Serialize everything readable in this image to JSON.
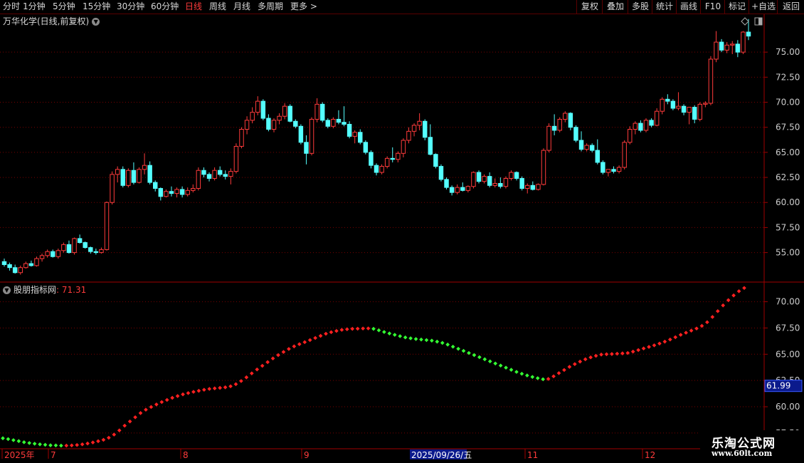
{
  "toolbar": {
    "periods": [
      "分时",
      "1分钟",
      "5分钟",
      "15分钟",
      "30分钟",
      "60分钟",
      "日线",
      "周线",
      "月线",
      "多周期",
      "更多 >"
    ],
    "active_period": "日线",
    "right_buttons": [
      "复权",
      "叠加",
      "多股",
      "统计",
      "画线",
      "F10",
      "标记",
      "+自选",
      "返回"
    ]
  },
  "chart_title": "万华化学(日线,前复权)",
  "indicator": {
    "name": "股朋指标网",
    "value": ": 71.31",
    "highlight_value": "61.99"
  },
  "main_axis": {
    "ticks": [
      "75.00",
      "72.50",
      "70.00",
      "67.50",
      "65.00",
      "62.50",
      "60.00",
      "57.50",
      "55.00"
    ]
  },
  "ind_axis": {
    "ticks": [
      "70.00",
      "67.50",
      "65.00",
      "62.50",
      "60.00",
      "57.50"
    ]
  },
  "date_axis": {
    "labels": [
      "2025年",
      "7",
      "8",
      "9",
      "11",
      "12"
    ],
    "cursor_date": "2025/09/26/五"
  },
  "colors": {
    "up": "#ff3b3b",
    "down": "#54ffff",
    "grid": "#7a0000",
    "border": "#a00000",
    "line_up": "#ff2020",
    "line_down": "#33ff33"
  },
  "watermark": {
    "line1": "乐淘公式网",
    "line2": "www.60lt.com"
  },
  "chart_data": {
    "type": "candlestick",
    "main": {
      "ylim": [
        52.2,
        77.5
      ],
      "candles": [
        [
          54.1,
          54.4,
          53.6,
          53.8
        ],
        [
          53.8,
          54.0,
          53.2,
          53.5
        ],
        [
          53.5,
          53.8,
          52.9,
          53.0
        ],
        [
          53.0,
          53.7,
          52.8,
          53.5
        ],
        [
          53.5,
          54.1,
          53.4,
          53.9
        ],
        [
          53.9,
          54.2,
          53.6,
          53.7
        ],
        [
          53.7,
          54.6,
          53.6,
          54.4
        ],
        [
          54.4,
          54.9,
          54.1,
          54.7
        ],
        [
          54.7,
          55.3,
          54.5,
          55.1
        ],
        [
          55.1,
          55.3,
          54.5,
          54.6
        ],
        [
          54.6,
          55.4,
          54.4,
          55.2
        ],
        [
          55.2,
          56.0,
          55.0,
          55.8
        ],
        [
          55.8,
          56.2,
          54.9,
          55.0
        ],
        [
          55.0,
          56.5,
          54.8,
          56.4
        ],
        [
          56.4,
          56.8,
          55.9,
          56.0
        ],
        [
          56.0,
          56.1,
          55.4,
          55.5
        ],
        [
          55.5,
          55.6,
          54.9,
          55.1
        ],
        [
          55.1,
          55.4,
          54.8,
          55.0
        ],
        [
          55.0,
          55.5,
          54.9,
          55.3
        ],
        [
          55.3,
          60.1,
          55.2,
          60.0
        ],
        [
          60.0,
          63.1,
          59.8,
          62.8
        ],
        [
          62.8,
          63.6,
          62.0,
          63.3
        ],
        [
          63.3,
          63.6,
          61.5,
          61.7
        ],
        [
          61.7,
          63.4,
          61.5,
          63.2
        ],
        [
          63.2,
          64.0,
          61.8,
          62.0
        ],
        [
          62.0,
          63.5,
          61.9,
          63.3
        ],
        [
          63.3,
          64.9,
          62.8,
          63.7
        ],
        [
          63.7,
          64.1,
          61.8,
          62.0
        ],
        [
          62.0,
          62.2,
          61.1,
          61.4
        ],
        [
          61.4,
          61.5,
          60.2,
          60.6
        ],
        [
          60.6,
          61.3,
          60.5,
          61.1
        ],
        [
          61.1,
          61.6,
          60.6,
          60.9
        ],
        [
          60.9,
          61.5,
          60.5,
          61.3
        ],
        [
          61.3,
          61.6,
          60.5,
          60.8
        ],
        [
          60.8,
          61.5,
          60.6,
          61.2
        ],
        [
          61.2,
          61.8,
          61.0,
          61.4
        ],
        [
          61.4,
          63.5,
          61.2,
          63.2
        ],
        [
          63.2,
          63.5,
          62.5,
          62.8
        ],
        [
          62.8,
          63.0,
          62.1,
          62.4
        ],
        [
          62.4,
          63.5,
          62.2,
          63.2
        ],
        [
          63.2,
          63.6,
          62.6,
          62.8
        ],
        [
          62.8,
          63.2,
          62.3,
          62.6
        ],
        [
          62.6,
          63.4,
          61.8,
          63.1
        ],
        [
          63.1,
          65.9,
          62.9,
          65.6
        ],
        [
          65.6,
          67.5,
          65.4,
          67.3
        ],
        [
          67.3,
          68.6,
          66.8,
          68.2
        ],
        [
          68.2,
          69.5,
          67.9,
          69.0
        ],
        [
          69.0,
          70.6,
          68.7,
          70.1
        ],
        [
          70.1,
          70.3,
          68.2,
          68.4
        ],
        [
          68.4,
          68.8,
          67.1,
          67.3
        ],
        [
          67.3,
          68.4,
          67.0,
          68.2
        ],
        [
          68.2,
          68.9,
          67.8,
          68.6
        ],
        [
          68.6,
          69.9,
          68.3,
          69.6
        ],
        [
          69.6,
          69.8,
          68.0,
          68.1
        ],
        [
          68.1,
          68.3,
          67.4,
          67.6
        ],
        [
          67.6,
          67.8,
          65.8,
          66.0
        ],
        [
          66.0,
          66.7,
          63.8,
          64.9
        ],
        [
          64.9,
          68.5,
          64.7,
          68.3
        ],
        [
          68.3,
          70.4,
          68.0,
          69.8
        ],
        [
          69.8,
          70.0,
          68.0,
          68.2
        ],
        [
          68.2,
          68.4,
          67.4,
          67.6
        ],
        [
          67.6,
          68.5,
          67.4,
          68.3
        ],
        [
          68.3,
          69.2,
          67.8,
          68.0
        ],
        [
          68.0,
          69.6,
          67.6,
          67.8
        ],
        [
          67.8,
          68.1,
          66.4,
          66.6
        ],
        [
          66.6,
          67.2,
          65.9,
          67.0
        ],
        [
          67.0,
          67.3,
          65.8,
          66.0
        ],
        [
          66.0,
          66.2,
          64.8,
          65.0
        ],
        [
          65.0,
          65.2,
          63.4,
          63.7
        ],
        [
          63.7,
          63.9,
          62.7,
          63.0
        ],
        [
          63.0,
          63.8,
          62.8,
          63.6
        ],
        [
          63.6,
          64.6,
          63.4,
          64.4
        ],
        [
          64.4,
          65.5,
          64.0,
          64.3
        ],
        [
          64.3,
          65.1,
          64.0,
          64.9
        ],
        [
          64.9,
          66.4,
          64.5,
          66.2
        ],
        [
          66.2,
          67.5,
          65.9,
          67.1
        ],
        [
          67.1,
          67.9,
          66.6,
          67.7
        ],
        [
          67.7,
          68.9,
          67.2,
          68.1
        ],
        [
          68.1,
          68.3,
          66.2,
          66.5
        ],
        [
          66.5,
          67.8,
          64.7,
          64.8
        ],
        [
          64.8,
          64.9,
          63.4,
          63.6
        ],
        [
          63.6,
          63.8,
          62.1,
          62.3
        ],
        [
          62.3,
          62.5,
          61.3,
          61.5
        ],
        [
          61.5,
          61.7,
          60.7,
          61.0
        ],
        [
          61.0,
          61.8,
          60.8,
          61.5
        ],
        [
          61.5,
          62.0,
          61.1,
          61.2
        ],
        [
          61.2,
          61.7,
          61.0,
          61.6
        ],
        [
          61.6,
          63.1,
          61.4,
          63.0
        ],
        [
          63.0,
          63.2,
          61.9,
          62.1
        ],
        [
          62.1,
          62.8,
          61.9,
          62.6
        ],
        [
          62.6,
          63.0,
          61.5,
          61.7
        ],
        [
          61.7,
          62.4,
          61.5,
          61.9
        ],
        [
          61.9,
          62.5,
          61.4,
          61.6
        ],
        [
          61.6,
          62.6,
          61.4,
          62.4
        ],
        [
          62.4,
          63.2,
          62.2,
          63.0
        ],
        [
          63.0,
          63.1,
          62.2,
          62.4
        ],
        [
          62.4,
          62.6,
          61.2,
          61.4
        ],
        [
          61.4,
          61.9,
          60.9,
          61.7
        ],
        [
          61.7,
          62.1,
          61.2,
          61.3
        ],
        [
          61.3,
          61.9,
          61.2,
          61.8
        ],
        [
          61.8,
          65.4,
          61.7,
          65.2
        ],
        [
          65.2,
          67.9,
          65.0,
          67.6
        ],
        [
          67.6,
          68.8,
          66.7,
          67.2
        ],
        [
          67.2,
          68.5,
          67.0,
          68.3
        ],
        [
          68.3,
          69.1,
          68.0,
          68.9
        ],
        [
          68.9,
          69.0,
          67.2,
          67.5
        ],
        [
          67.5,
          67.7,
          66.0,
          66.2
        ],
        [
          66.2,
          67.1,
          65.1,
          65.3
        ],
        [
          65.3,
          65.9,
          65.1,
          65.7
        ],
        [
          65.7,
          65.9,
          65.0,
          65.2
        ],
        [
          65.2,
          66.3,
          63.8,
          64.0
        ],
        [
          64.0,
          64.2,
          62.8,
          63.0
        ],
        [
          63.0,
          63.2,
          62.6,
          63.3
        ],
        [
          63.3,
          63.6,
          62.9,
          63.1
        ],
        [
          63.1,
          63.7,
          62.9,
          63.5
        ],
        [
          63.5,
          66.2,
          63.3,
          66.0
        ],
        [
          66.0,
          67.6,
          65.8,
          67.3
        ],
        [
          67.3,
          68.1,
          66.8,
          67.9
        ],
        [
          67.9,
          68.2,
          67.0,
          67.2
        ],
        [
          67.2,
          68.4,
          67.0,
          68.2
        ],
        [
          68.2,
          68.4,
          67.5,
          67.7
        ],
        [
          67.7,
          69.4,
          67.6,
          69.1
        ],
        [
          69.1,
          70.5,
          68.8,
          70.3
        ],
        [
          70.3,
          70.8,
          69.8,
          70.1
        ],
        [
          70.1,
          70.3,
          69.2,
          69.4
        ],
        [
          69.4,
          71.0,
          69.2,
          69.6
        ],
        [
          69.6,
          69.8,
          68.7,
          69.0
        ],
        [
          69.0,
          69.3,
          67.8,
          69.5
        ],
        [
          69.5,
          69.7,
          67.9,
          68.3
        ],
        [
          68.3,
          70.0,
          68.1,
          69.8
        ],
        [
          69.8,
          70.1,
          69.5,
          69.9
        ],
        [
          69.9,
          74.6,
          69.7,
          74.3
        ],
        [
          74.3,
          77.1,
          74.0,
          76.0
        ],
        [
          76.0,
          76.3,
          75.0,
          75.2
        ],
        [
          75.2,
          76.0,
          74.9,
          75.7
        ],
        [
          75.7,
          76.1,
          74.8,
          75.8
        ],
        [
          75.8,
          76.2,
          74.5,
          75.0
        ],
        [
          75.0,
          77.1,
          74.8,
          77.0
        ],
        [
          77.0,
          78.3,
          76.2,
          76.6
        ]
      ]
    },
    "indicator": {
      "ylim": [
        56.0,
        71.6
      ],
      "values": [
        57.0,
        56.92,
        56.82,
        56.73,
        56.62,
        56.55,
        56.48,
        56.42,
        56.38,
        56.33,
        56.32,
        56.3,
        56.3,
        56.32,
        56.36,
        56.42,
        56.5,
        56.6,
        56.72,
        56.85,
        57.05,
        57.35,
        57.75,
        58.2,
        58.6,
        59.0,
        59.4,
        59.72,
        59.98,
        60.22,
        60.45,
        60.65,
        60.85,
        61.02,
        61.18,
        61.3,
        61.42,
        61.52,
        61.62,
        61.7,
        61.75,
        61.8,
        61.85,
        61.95,
        62.15,
        62.45,
        62.8,
        63.18,
        63.55,
        63.9,
        64.25,
        64.6,
        64.92,
        65.22,
        65.5,
        65.75,
        65.96,
        66.15,
        66.35,
        66.55,
        66.75,
        66.95,
        67.1,
        67.22,
        67.32,
        67.38,
        67.42,
        67.43,
        67.45,
        67.46,
        67.42,
        67.28,
        67.12,
        66.98,
        66.85,
        66.72,
        66.6,
        66.52,
        66.45,
        66.4,
        66.35,
        66.3,
        66.2,
        66.08,
        65.92,
        65.72,
        65.52,
        65.32,
        65.12,
        64.92,
        64.72,
        64.52,
        64.32,
        64.12,
        63.92,
        63.72,
        63.52,
        63.32,
        63.14,
        62.98,
        62.84,
        62.72,
        62.62,
        62.65,
        62.9,
        63.2,
        63.5,
        63.8,
        64.06,
        64.3,
        64.52,
        64.7,
        64.85,
        64.97,
        65.0,
        65.02,
        65.05,
        65.08,
        65.12,
        65.25,
        65.4,
        65.55,
        65.7,
        65.85,
        66.02,
        66.2,
        66.4,
        66.62,
        66.85,
        67.05,
        67.25,
        67.45,
        67.7,
        68.05,
        68.55,
        69.1,
        69.65,
        70.15,
        70.6,
        71.0,
        71.31
      ]
    }
  }
}
